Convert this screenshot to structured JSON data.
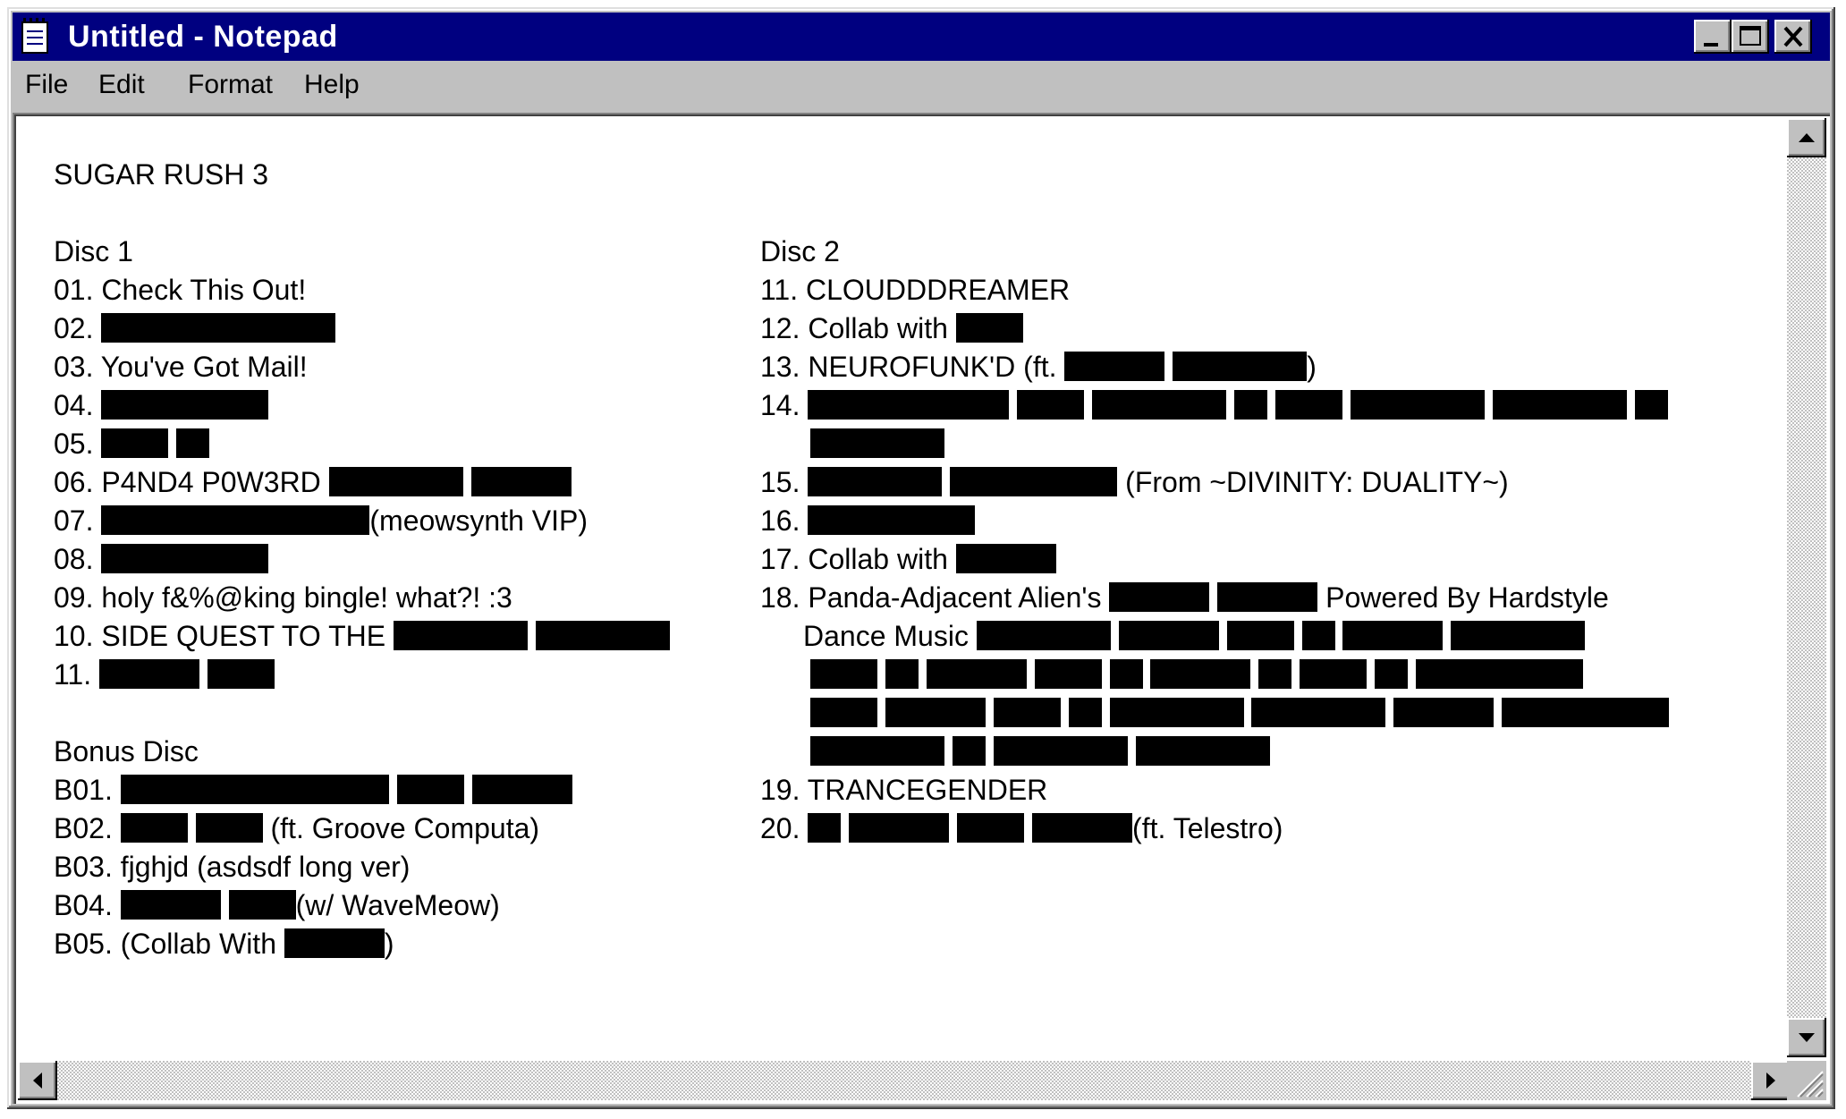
{
  "window": {
    "title": "Untitled - Notepad",
    "icons": {
      "app": "notepad-icon",
      "minimize": "minimize-icon",
      "maximize": "maximize-icon",
      "close": "close-icon"
    }
  },
  "menu": [
    "File",
    "Edit",
    "Format",
    "Help"
  ],
  "document": {
    "title": "SUGAR RUSH 3",
    "disc1": {
      "heading": "Disc 1",
      "tracks": {
        "t01": "01. Check This Out!",
        "t02": "02.",
        "t03": "03. You've Got Mail!",
        "t04": "04.",
        "t05": "05.",
        "t06": "06. P4ND4 P0W3RD",
        "t07": "07.",
        "t07b": "(meowsynth VIP)",
        "t08": "08.",
        "t09": "09. holy f&%@king bingle! what?! :3",
        "t10": "10. SIDE QUEST TO THE",
        "t11": "11."
      }
    },
    "bonus": {
      "heading": "Bonus Disc",
      "tracks": {
        "b01": "B01.",
        "b02": "B02.",
        "b02b": "(ft. Groove Computa)",
        "b03": "B03.  fjghjd (asdsdf long ver)",
        "b04": "B04.",
        "b04b": "(w/ WaveMeow)",
        "b05": "B05. (Collab With",
        "b05b": ")"
      }
    },
    "disc2": {
      "heading": "Disc 2",
      "tracks": {
        "t11": "11. CLOUDDDREAMER",
        "t12": "12. Collab with",
        "t13": "13. NEUROFUNK'D (ft.",
        "t13b": ")",
        "t14": "14.",
        "t15": "15.",
        "t15b": "(From ~DIVINITY: DUALITY~)",
        "t16": "16.",
        "t17": "17. Collab with",
        "t18": "18. Panda-Adjacent Alien's",
        "t18b": "Powered By Hardstyle",
        "t18c": "Dance Music",
        "t19": "19. TRANCEGENDER",
        "t20": "20.",
        "t20b": "(ft. Telestro)"
      }
    }
  },
  "colors": {
    "titlebar": "#000080",
    "chrome": "#c0c0c0",
    "redaction": "#000000"
  }
}
